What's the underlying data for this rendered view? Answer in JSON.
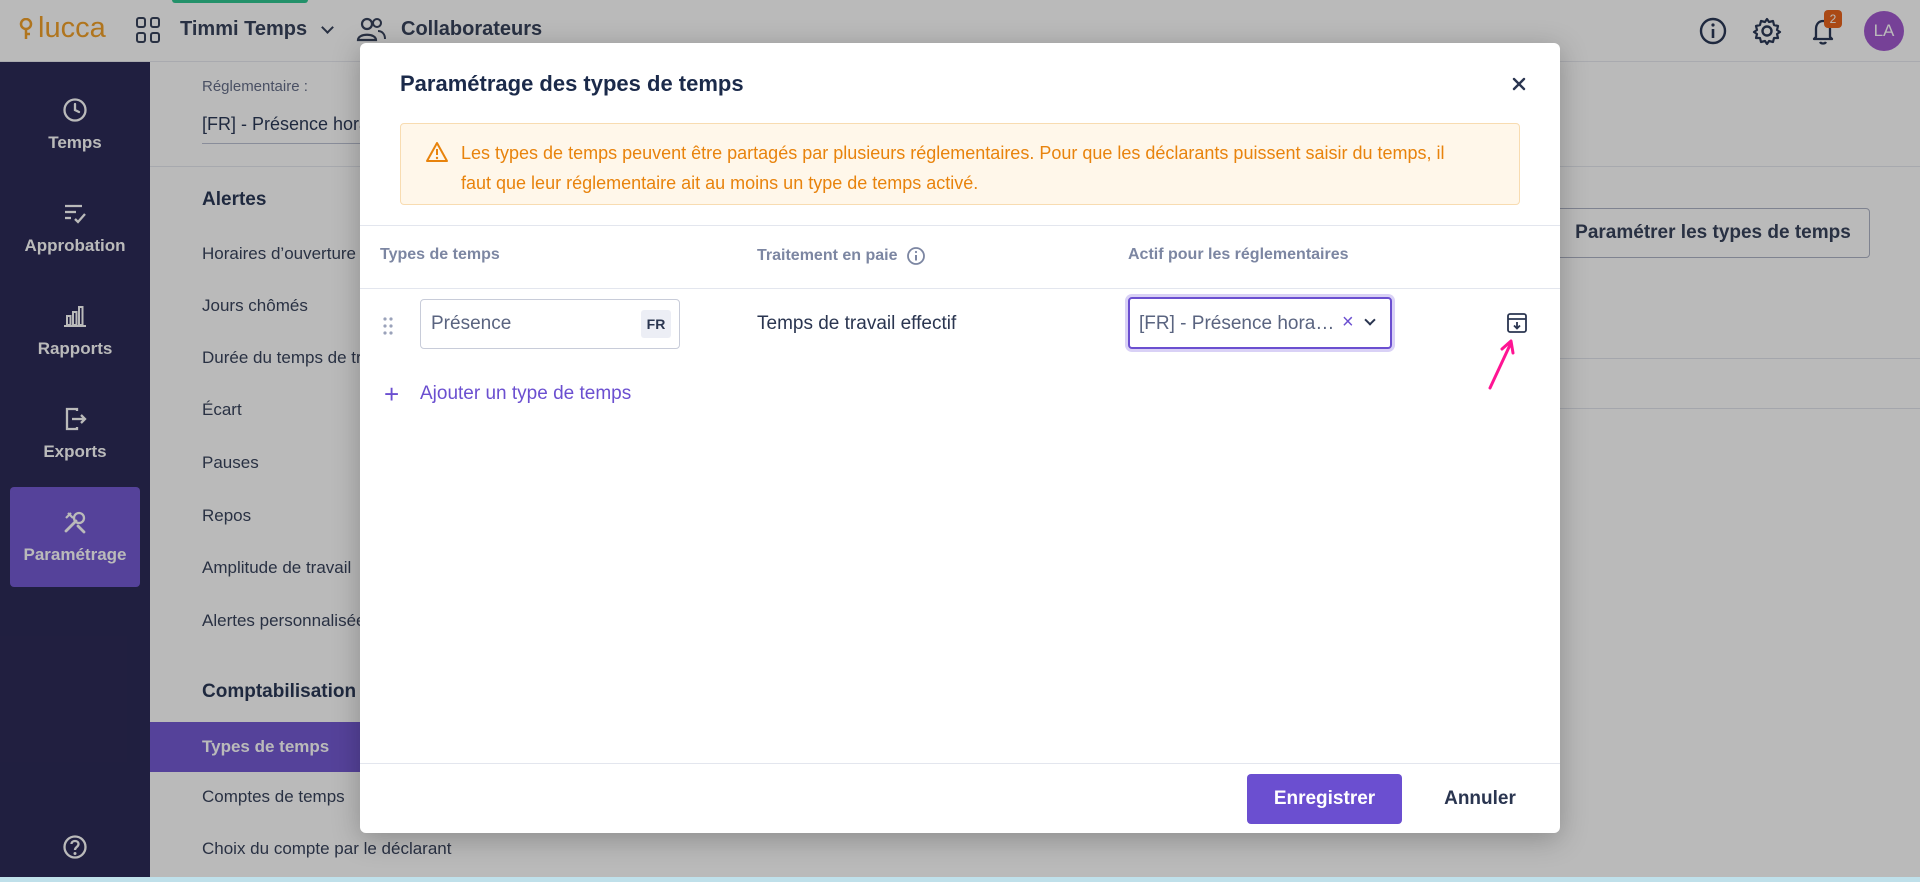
{
  "header": {
    "logo": "lucca",
    "app_name": "Timmi Temps",
    "nav_collaborateurs": "Collaborateurs",
    "notification_count": "2",
    "avatar_initials": "LA"
  },
  "sidebar": {
    "items": [
      {
        "label": "Temps",
        "icon": "clock-icon"
      },
      {
        "label": "Approbation",
        "icon": "approval-icon"
      },
      {
        "label": "Rapports",
        "icon": "chart-icon"
      },
      {
        "label": "Exports",
        "icon": "export-icon"
      },
      {
        "label": "Paramétrage",
        "icon": "tools-icon",
        "active": true
      }
    ]
  },
  "page": {
    "reglementaire_label": "Réglementaire :",
    "reglementaire_value": "[FR] - Présence horaire",
    "alerts_title": "Alertes",
    "alerts_items": [
      "Horaires d’ouverture /",
      "Jours chômés",
      "Durée du temps de tra",
      "Écart",
      "Pauses",
      "Repos",
      "Amplitude de travail",
      "Alertes personnalisée"
    ],
    "compta_title": "Comptabilisation d",
    "compta_items": [
      "Types de temps",
      "Comptes de temps",
      "Choix du compte par le déclarant"
    ],
    "configure_button": "Paramétrer les types de temps"
  },
  "modal": {
    "title": "Paramétrage des types de temps",
    "alert": "Les types de temps peuvent être partagés par plusieurs réglementaires. Pour que les déclarants puissent saisir du temps, il faut que leur réglementaire ait au moins un type de temps activé.",
    "columns": {
      "types": "Types de temps",
      "traitement": "Traitement en paie",
      "actif": "Actif pour les réglementaires"
    },
    "row": {
      "name": "Présence",
      "lang": "FR",
      "traitement": "Temps de travail effectif",
      "actif_value": "[FR] - Présence horaire (heures)"
    },
    "add_label": "Ajouter un type de temps",
    "save_button": "Enregistrer",
    "cancel_button": "Annuler"
  },
  "colors": {
    "primary": "#6b4fd0",
    "sidebar_bg": "#1d1b4c",
    "warning": "#e8830c",
    "annotation": "#ff1493"
  }
}
